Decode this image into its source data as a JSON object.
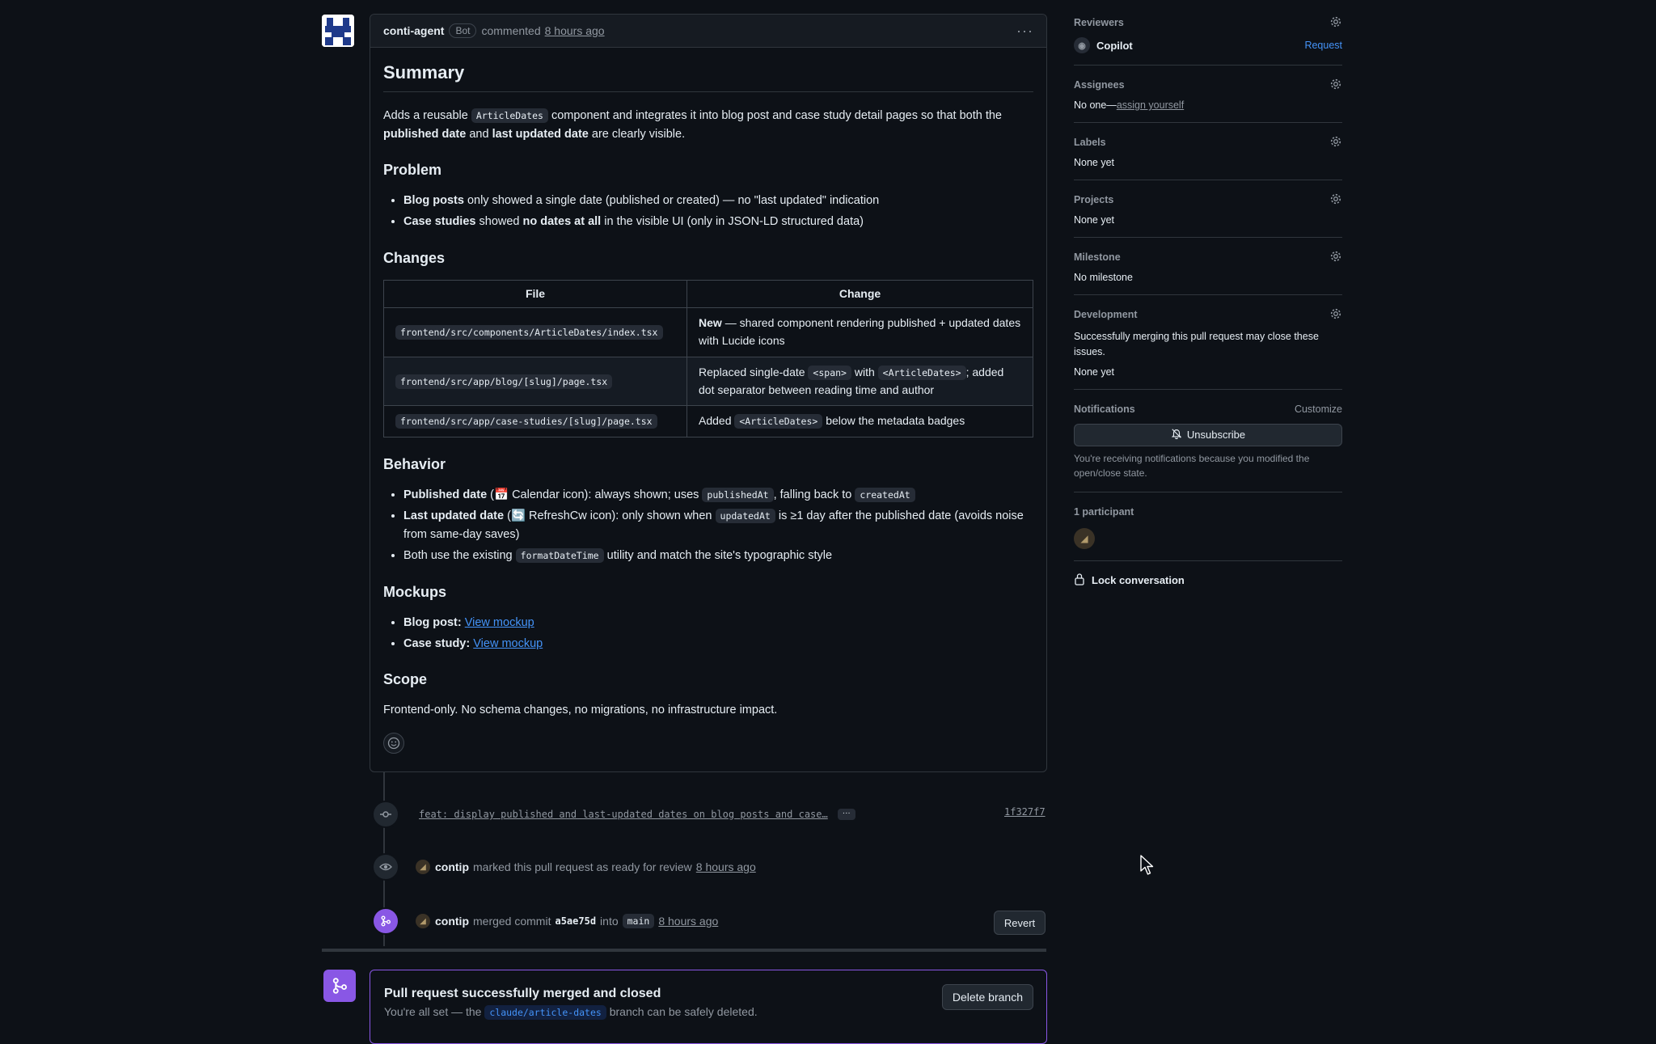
{
  "comment": {
    "author": "conti-agent",
    "badge": "Bot",
    "action": "commented",
    "time": "8 hours ago",
    "menu_glyph": "···"
  },
  "body": {
    "summary_heading": "Summary",
    "summary_p1": "Adds a reusable",
    "summary_code": "ArticleDates",
    "summary_p2": "component and integrates it into blog post and case study detail pages so that both the",
    "summary_b1": "published date",
    "summary_and": "and",
    "summary_b2": "last updated date",
    "summary_p3": "are clearly visible.",
    "problem_heading": "Problem",
    "problem_items": [
      {
        "bold": "Blog posts",
        "text": "only showed a single date (published or created) — no \"last updated\" indication"
      },
      {
        "bold": "Case studies",
        "text_pre": "showed",
        "bold2": "no dates at all",
        "text": "in the visible UI (only in JSON-LD structured data)"
      }
    ],
    "changes_heading": "Changes",
    "table": {
      "headers": [
        "File",
        "Change"
      ],
      "rows": [
        {
          "file": "frontend/src/components/ArticleDates/index.tsx",
          "change_bold": "New",
          "change": "— shared component rendering published + updated dates with Lucide icons"
        },
        {
          "file": "frontend/src/app/blog/[slug]/page.tsx",
          "change_pre": "Replaced single-date",
          "code1": "<span>",
          "change_mid": "with",
          "code2": "<ArticleDates>",
          "change_post": "; added dot separator between reading time and author"
        },
        {
          "file": "frontend/src/app/case-studies/[slug]/page.tsx",
          "change_pre": "Added",
          "code1": "<ArticleDates>",
          "change_post": "below the metadata badges"
        }
      ]
    },
    "behavior_heading": "Behavior",
    "behavior_items": [
      {
        "bold": "Published date",
        "text_a": "(📅 Calendar icon): always shown; uses",
        "code_a": "publishedAt",
        "text_b": ", falling back to",
        "code_b": "createdAt"
      },
      {
        "bold": "Last updated date",
        "text_a": "(🔄 RefreshCw icon): only shown when",
        "code_a": "updatedAt",
        "text_b": "is ≥1 day after the published date (avoids noise from same-day saves)"
      },
      {
        "text_a": "Both use the existing",
        "code_a": "formatDateTime",
        "text_b": "utility and match the site's typographic style"
      }
    ],
    "mockups_heading": "Mockups",
    "mockups": [
      {
        "bold": "Blog post",
        "link": "View mockup"
      },
      {
        "bold": "Case study",
        "link": "View mockup"
      }
    ],
    "scope_heading": "Scope",
    "scope_text": "Frontend-only. No schema changes, no migrations, no infrastructure impact."
  },
  "timeline": {
    "commit_message": "feat: display published and last-updated dates on blog posts and case…",
    "commit_more": "···",
    "commit_sha": "1f327f7",
    "ready_user": "contip",
    "ready_text": "marked this pull request as ready for review",
    "ready_time": "8 hours ago",
    "merge_user": "contip",
    "merge_text": "merged commit",
    "merge_commit": "a5ae75d",
    "merge_into": "into",
    "merge_branch": "main",
    "merge_time": "8 hours ago",
    "revert_label": "Revert"
  },
  "merged_box": {
    "title": "Pull request successfully merged and closed",
    "sub_pre": "You're all set — the",
    "branch": "claude/article-dates",
    "sub_post": "branch can be safely deleted.",
    "delete_label": "Delete branch"
  },
  "sidebar": {
    "reviewers_label": "Reviewers",
    "reviewer_name": "Copilot",
    "reviewer_request": "Request",
    "assignees_label": "Assignees",
    "assignees_none": "No one—",
    "assign_yourself": "assign yourself",
    "labels_label": "Labels",
    "labels_value": "None yet",
    "projects_label": "Projects",
    "projects_value": "None yet",
    "milestone_label": "Milestone",
    "milestone_value": "No milestone",
    "development_label": "Development",
    "development_text": "Successfully merging this pull request may close these issues.",
    "development_value": "None yet",
    "notifications_label": "Notifications",
    "notifications_customize": "Customize",
    "unsubscribe_label": "Unsubscribe",
    "notifications_reason": "You're receiving notifications because you modified the open/close state.",
    "participants_label": "1 participant",
    "lock_label": "Lock conversation"
  },
  "colors": {
    "background": "#0d1117",
    "border": "#30363d",
    "link": "#4493f8",
    "merged_purple": "#8957e5",
    "muted_text": "#9198a1"
  },
  "icons": [
    "gear-icon",
    "bell-slash-icon",
    "lock-icon",
    "commit-icon",
    "eye-icon",
    "merge-icon",
    "smiley-icon",
    "copilot-icon"
  ]
}
